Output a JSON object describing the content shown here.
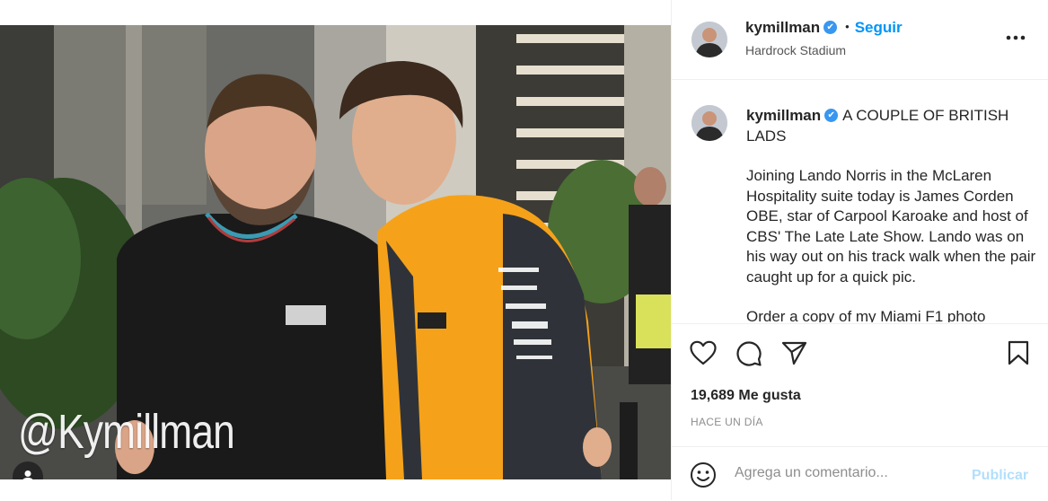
{
  "post": {
    "watermark": "@Kymillman",
    "photo_alt": "",
    "header": {
      "username": "kymillman",
      "verified_glyph": "✔",
      "separator": "•",
      "follow_label": "Seguir",
      "location": "Hardrock Stadium",
      "more_label": "•••"
    },
    "caption": {
      "username": "kymillman",
      "title": "A COUPLE OF BRITISH LADS",
      "body": "Joining Lando Norris in the McLaren Hospitality suite today is James Corden OBE, star of Carpool Karoake and host of CBS' The Late Late Show. Lando was on his way out on his track walk when the pair caught up for a quick pic.",
      "more": "Order a copy of my Miami F1 photo"
    },
    "actions": {
      "like_icon": "heart-icon",
      "comment_icon": "comment-icon",
      "share_icon": "share-icon",
      "save_icon": "bookmark-icon"
    },
    "likes": "19,689 Me gusta",
    "time_ago": "HACE UN DÍA",
    "comment": {
      "placeholder": "Agrega un comentario...",
      "publish_label": "Publicar",
      "emoji_icon": "emoji-icon"
    }
  },
  "colors": {
    "accent": "#0095f6",
    "verified": "#3897f0",
    "publish_disabled": "#b2dffc",
    "text": "#262626",
    "muted": "#8e8e8e"
  }
}
